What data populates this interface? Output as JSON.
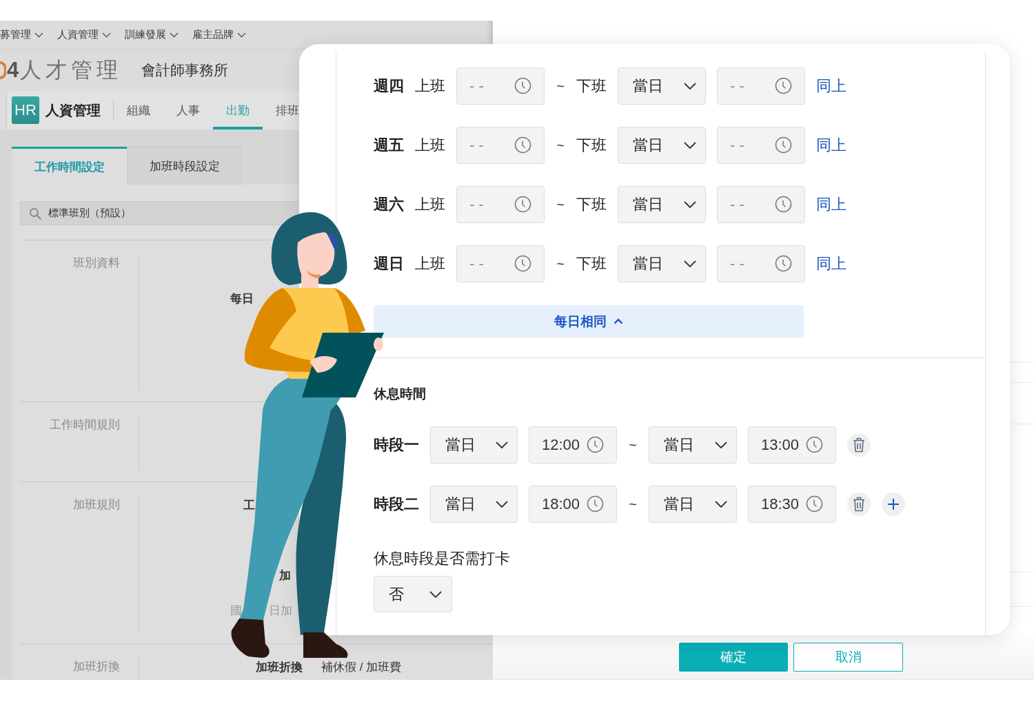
{
  "top_nav": [
    {
      "label": "募管理"
    },
    {
      "label": "人資管理"
    },
    {
      "label": "訓練發展"
    },
    {
      "label": "雇主品牌"
    }
  ],
  "header": {
    "logo": "**4**人才管理",
    "company": "會計師事務所"
  },
  "module_nav": {
    "badge": "HR",
    "title": "人資管理",
    "tabs": [
      {
        "label": "組織",
        "selected": false
      },
      {
        "label": "人事",
        "selected": false
      },
      {
        "label": "出勤",
        "selected": true
      },
      {
        "label": "排班",
        "selected": false
      }
    ]
  },
  "settings_tabs": [
    {
      "label": "工作時間設定",
      "selected": true
    },
    {
      "label": "加班時段設定",
      "selected": false
    }
  ],
  "search": {
    "value": "標準班別（預設）"
  },
  "form_rows": [
    {
      "label": "班別資料",
      "fragments": [
        {
          "text": "每日",
          "kind": "label"
        }
      ]
    },
    {
      "label": "工作時間規則"
    },
    {
      "label": "加班規則",
      "fragments": [
        {
          "text": "工",
          "kind": "label"
        },
        {
          "text": "加",
          "kind": "label"
        },
        {
          "text": "國",
          "kind": "muted"
        },
        {
          "text": "日加",
          "kind": "muted"
        }
      ]
    },
    {
      "label": "加班折換",
      "fragments": [
        {
          "text": "加班折換",
          "kind": "label"
        },
        {
          "text": "補休假 / 加班費",
          "kind": "value"
        }
      ]
    }
  ],
  "schedule_dialog": {
    "days": [
      {
        "day": "週四",
        "start_label": "上班",
        "start_time": {
          "placeholder": "- -"
        },
        "separator": "~",
        "end_label": "下班",
        "end_day": "當日",
        "end_time": {
          "placeholder": "- -"
        },
        "link": "同上"
      },
      {
        "day": "週五",
        "start_label": "上班",
        "start_time": {
          "placeholder": "- -"
        },
        "separator": "~",
        "end_label": "下班",
        "end_day": "當日",
        "end_time": {
          "placeholder": "- -"
        },
        "link": "同上"
      },
      {
        "day": "週六",
        "start_label": "上班",
        "start_time": {
          "placeholder": "- -"
        },
        "separator": "~",
        "end_label": "下班",
        "end_day": "當日",
        "end_time": {
          "placeholder": "- -"
        },
        "link": "同上"
      },
      {
        "day": "週日",
        "start_label": "上班",
        "start_time": {
          "placeholder": "- -"
        },
        "separator": "~",
        "end_label": "下班",
        "end_day": "當日",
        "end_time": {
          "placeholder": "- -"
        },
        "link": "同上"
      }
    ],
    "toggle_button": {
      "label": "每日相同",
      "expanded": true
    },
    "break_section": {
      "title": "休息時間",
      "periods": [
        {
          "label": "時段一",
          "start_day": "當日",
          "start_time": {
            "value": "12:00"
          },
          "separator": "~",
          "end_day": "當日",
          "end_time": {
            "value": "13:00"
          },
          "add_button": false
        },
        {
          "label": "時段二",
          "start_day": "當日",
          "start_time": {
            "value": "18:00"
          },
          "separator": "~",
          "end_day": "當日",
          "end_time": {
            "value": "18:30"
          },
          "add_button": true
        }
      ]
    },
    "punch_question": {
      "label": "休息時段是否需打卡",
      "value": "否"
    }
  },
  "footer_buttons": [
    {
      "label": "確定",
      "kind": "primary"
    },
    {
      "label": "取消",
      "kind": "secondary"
    }
  ]
}
